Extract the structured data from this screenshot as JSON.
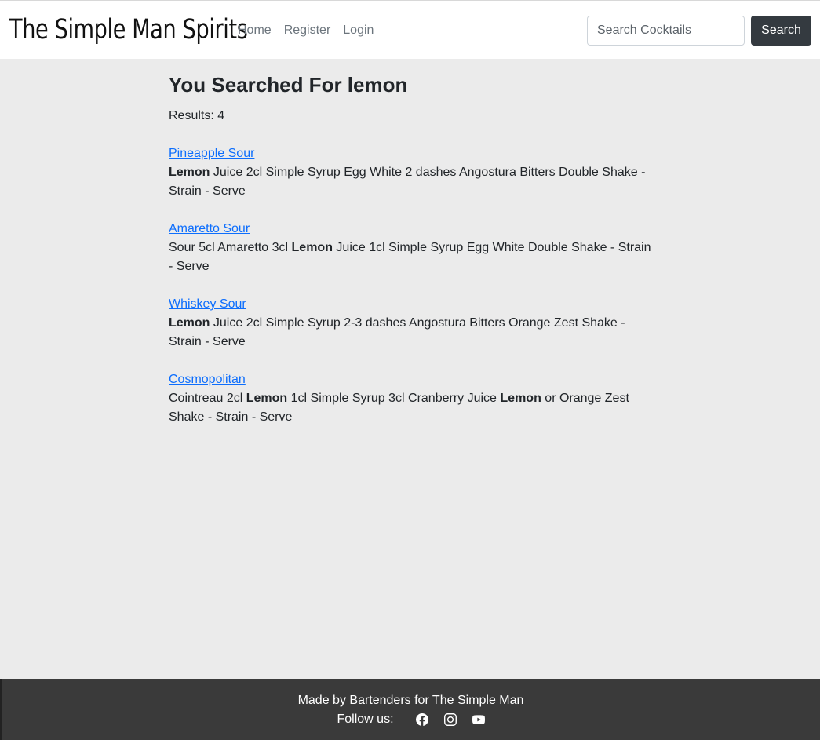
{
  "navbar": {
    "brand": "The Simple Man Spirits",
    "links": [
      "Home",
      "Register",
      "Login"
    ],
    "search_placeholder": "Search Cocktails",
    "search_button": "Search"
  },
  "main": {
    "heading": "You Searched For lemon",
    "results_count": "Results: 4",
    "results": [
      {
        "name": "Pineapple Sour",
        "description": [
          {
            "text": "Lemon",
            "bold": true
          },
          {
            "text": " Juice 2cl Simple Syrup Egg White 2 dashes Angostura Bitters Double Shake - Strain - Serve",
            "bold": false
          }
        ]
      },
      {
        "name": "Amaretto Sour",
        "description": [
          {
            "text": "Sour 5cl Amaretto 3cl ",
            "bold": false
          },
          {
            "text": "Lemon",
            "bold": true
          },
          {
            "text": " Juice 1cl Simple Syrup Egg White Double Shake - Strain - Serve",
            "bold": false
          }
        ]
      },
      {
        "name": "Whiskey Sour",
        "description": [
          {
            "text": "Lemon",
            "bold": true
          },
          {
            "text": " Juice 2cl Simple Syrup 2-3 dashes Angostura Bitters Orange Zest Shake - Strain - Serve",
            "bold": false
          }
        ]
      },
      {
        "name": "Cosmopolitan",
        "description": [
          {
            "text": "Cointreau 2cl ",
            "bold": false
          },
          {
            "text": "Lemon",
            "bold": true
          },
          {
            "text": " 1cl Simple Syrup 3cl Cranberry Juice ",
            "bold": false
          },
          {
            "text": "Lemon",
            "bold": true
          },
          {
            "text": " or Orange Zest Shake - Strain - Serve",
            "bold": false
          }
        ]
      }
    ]
  },
  "footer": {
    "credit": "Made by Bartenders for The Simple Man",
    "follow_label": "Follow us:",
    "social_icons": [
      "facebook-icon",
      "instagram-icon",
      "youtube-icon"
    ]
  }
}
